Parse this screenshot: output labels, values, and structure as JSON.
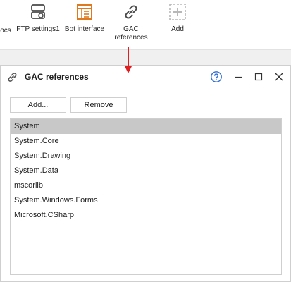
{
  "toolbar": {
    "items": [
      {
        "label": "ocs",
        "icon": "docs-icon"
      },
      {
        "label": "FTP settings1",
        "icon": "ftp-settings-icon"
      },
      {
        "label": "Bot interface",
        "icon": "bot-interface-icon"
      },
      {
        "label": "GAC\nreferences",
        "icon": "link-icon"
      },
      {
        "label": "Add",
        "icon": "add-icon"
      }
    ]
  },
  "dialog": {
    "title": "GAC references",
    "title_icon": "link-icon",
    "controls": [
      "help-icon",
      "minimize-icon",
      "maximize-icon",
      "close-icon"
    ],
    "add_label": "Add...",
    "remove_label": "Remove",
    "references": [
      "System",
      "System.Core",
      "System.Drawing",
      "System.Data",
      "mscorlib",
      "System.Windows.Forms",
      "Microsoft.CSharp"
    ],
    "selected": "System"
  },
  "colors": {
    "accent_orange": "#e0781e",
    "help_blue": "#2f6fd6",
    "arrow_red": "#e02020",
    "selection_grey": "#c8c8c8",
    "toolbar_band": "#f0f0f0"
  }
}
